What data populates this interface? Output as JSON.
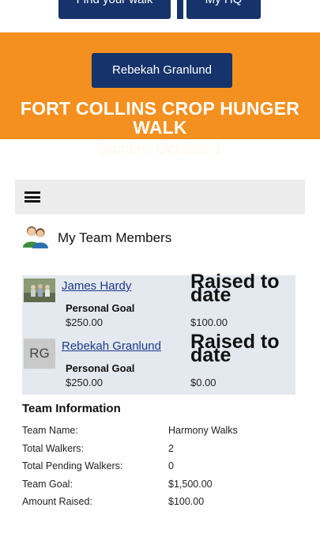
{
  "nav": {
    "find_walk_label": "Find your walk",
    "my_hq_label": "My HQ",
    "user_label": "Rebekah Granlund"
  },
  "event": {
    "title": "FORT COLLINS CROP HUNGER WALK",
    "date": "Sunday, October 1"
  },
  "colors": {
    "banner": "#f4901f",
    "nav_button": "#16336b",
    "members_bg": "#e4e8ef",
    "link": "#1a3a8a"
  },
  "section": {
    "title": "My Team Members",
    "icon": "team-people-icon"
  },
  "members": [
    {
      "name": "James Hardy",
      "avatar": "photo",
      "raised_heading": "Raised to date",
      "goal_label": "Personal Goal",
      "goal": "$250.00",
      "raised": "$100.00"
    },
    {
      "name": "Rebekah Granlund",
      "avatar": "RG",
      "raised_heading": "Raised to date",
      "goal_label": "Personal Goal",
      "goal": "$250.00",
      "raised": "$0.00"
    }
  ],
  "team_info": {
    "title": "Team Information",
    "rows": [
      {
        "label": "Team Name:",
        "value": "Harmony Walks"
      },
      {
        "label": "Total Walkers:",
        "value": "2"
      },
      {
        "label": "Total Pending Walkers:",
        "value": "0"
      },
      {
        "label": "Team Goal:",
        "value": "$1,500.00"
      },
      {
        "label": "Amount Raised:",
        "value": "$100.00"
      }
    ]
  }
}
